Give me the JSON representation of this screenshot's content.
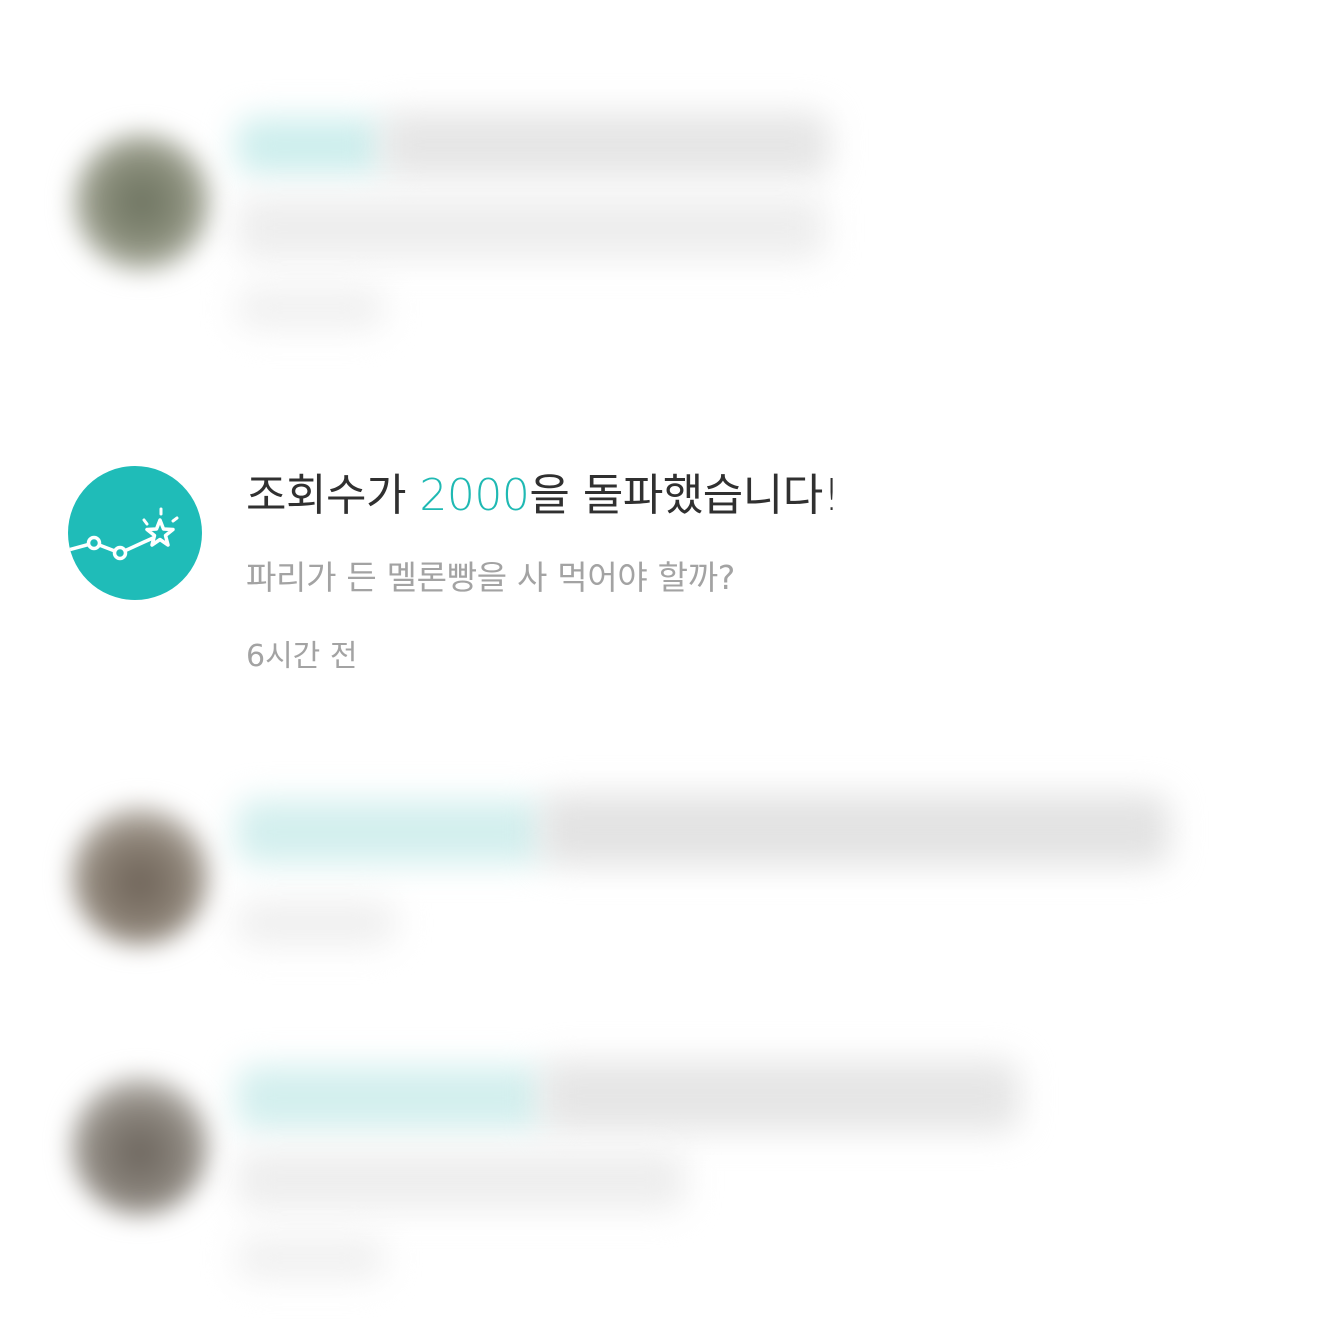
{
  "notifications": [
    {
      "state": "obscured",
      "avatar": "user-photo-avatar"
    },
    {
      "state": "visible",
      "icon": "view-milestone-star-icon",
      "icon_color": "#1fbcb8",
      "title_prefix": "조회수가 ",
      "title_highlight": "2000",
      "title_suffix": "을 돌파했습니다!",
      "highlight_color": "#1fb9b3",
      "subtitle": "파리가 든 멜론빵을 사 먹어야 할까?",
      "time": "6시간 전"
    },
    {
      "state": "obscured",
      "avatar": "user-photo-avatar"
    },
    {
      "state": "obscured",
      "avatar": "user-photo-avatar"
    }
  ]
}
